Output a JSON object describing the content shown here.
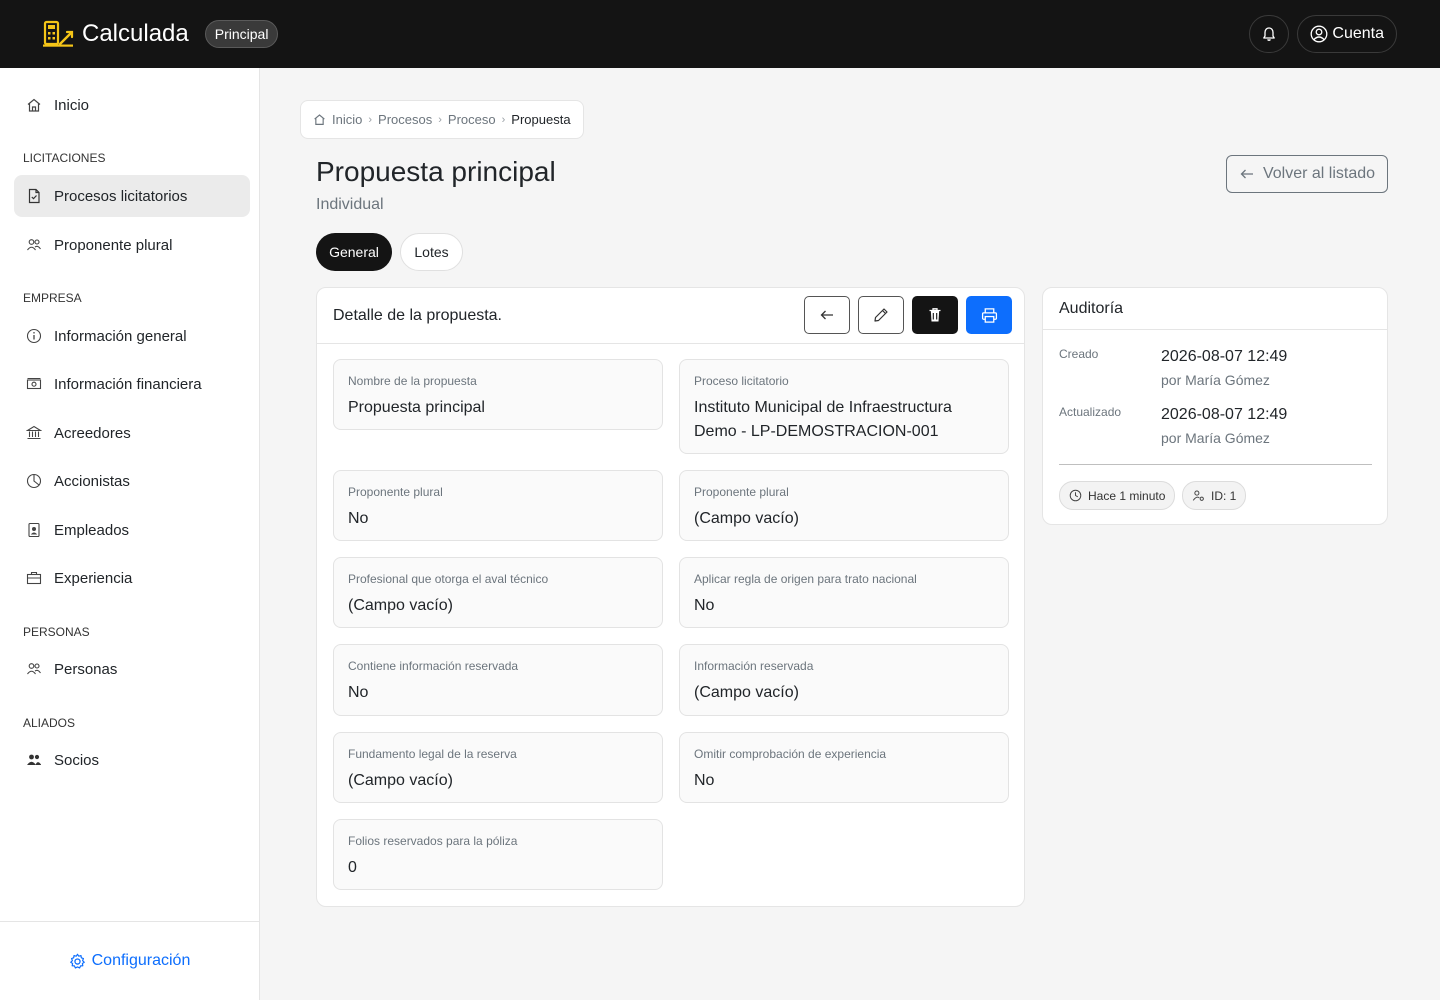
{
  "app": {
    "name": "Calculada",
    "badge": "Principal",
    "account_label": "Cuenta"
  },
  "sidebar": {
    "items": [
      {
        "label": "Inicio"
      },
      {
        "section": "LICITACIONES"
      },
      {
        "label": "Procesos licitatorios",
        "active": true
      },
      {
        "label": "Proponente plural"
      },
      {
        "section": "EMPRESA"
      },
      {
        "label": "Información general"
      },
      {
        "label": "Información financiera"
      },
      {
        "label": "Acreedores"
      },
      {
        "label": "Accionistas"
      },
      {
        "label": "Empleados"
      },
      {
        "label": "Experiencia"
      },
      {
        "section": "PERSONAS"
      },
      {
        "label": "Personas"
      },
      {
        "section": "ALIADOS"
      },
      {
        "label": "Socios"
      }
    ],
    "footer_label": "Configuración"
  },
  "breadcrumb": [
    "Inicio",
    "Procesos",
    "Proceso",
    "Propuesta"
  ],
  "page": {
    "title": "Propuesta principal",
    "subtitle": "Individual",
    "back_label": "Volver al listado"
  },
  "tabs": [
    "General",
    "Lotes"
  ],
  "detail": {
    "title": "Detalle de la propuesta.",
    "fields": [
      {
        "label": "Nombre de la propuesta",
        "value": "Propuesta principal"
      },
      {
        "label": "Proceso licitatorio",
        "value": "Instituto Municipal de Infraestructura Demo - LP-DEMOSTRACION-001"
      },
      {
        "label": "Proponente plural",
        "value": "No"
      },
      {
        "label": "Proponente plural",
        "value": "(Campo vacío)"
      },
      {
        "label": "Profesional que otorga el aval técnico",
        "value": "(Campo vacío)"
      },
      {
        "label": "Aplicar regla de origen para trato nacional",
        "value": "No"
      },
      {
        "label": "Contiene información reservada",
        "value": "No"
      },
      {
        "label": "Información reservada",
        "value": "(Campo vacío)"
      },
      {
        "label": "Fundamento legal de la reserva",
        "value": "(Campo vacío)"
      },
      {
        "label": "Omitir comprobación de experiencia",
        "value": "No"
      },
      {
        "label": "Folios reservados para la póliza",
        "value": "0"
      }
    ]
  },
  "audit": {
    "title": "Auditoría",
    "created_label": "Creado",
    "created_date": "2026-08-07 12:49",
    "created_by": "por María Gómez",
    "updated_label": "Actualizado",
    "updated_date": "2026-08-07 12:49",
    "updated_by": "por María Gómez",
    "chips": [
      "Hace 1 minuto",
      "ID: 1"
    ]
  },
  "colors": {
    "brand_icon": "#f5c518",
    "primary": "#0d6efd",
    "dark": "#141414"
  }
}
